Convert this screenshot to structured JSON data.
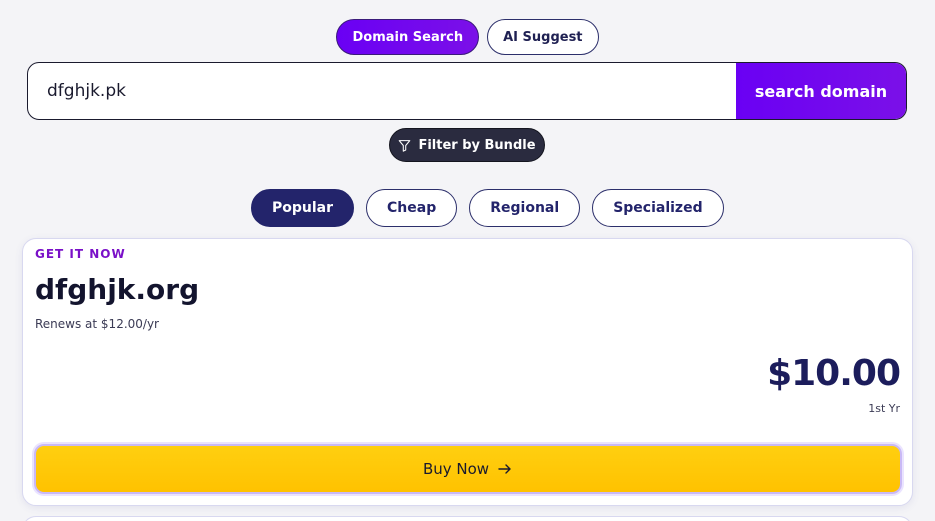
{
  "mode_toggle": {
    "domain_search": "Domain Search",
    "ai_suggest": "AI Suggest"
  },
  "search": {
    "value": "dfghjk.pk",
    "button_label": "search domain"
  },
  "filter": {
    "label": "Filter by Bundle",
    "icon": "filter-funnel-icon"
  },
  "categories": {
    "active": "Popular",
    "items": [
      "Popular",
      "Cheap",
      "Regional",
      "Specialized"
    ]
  },
  "result_card": {
    "eyebrow": "GET IT NOW",
    "domain": "dfghjk.org",
    "renewal": "Renews at $12.00/yr",
    "price": "$10.00",
    "price_period": "1st Yr",
    "buy_label": "Buy Now",
    "buy_icon": "arrow-right-icon"
  },
  "colors": {
    "accent_purple": "#6a00f4",
    "navy": "#23246b",
    "buy_yellow": "#ffc800",
    "eyebrow": "#7a10c8"
  }
}
